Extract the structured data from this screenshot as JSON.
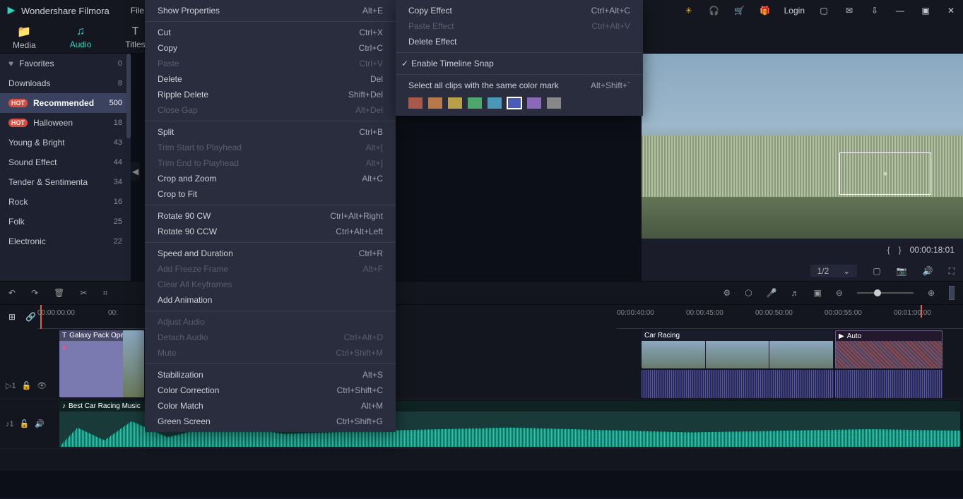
{
  "app_name": "Wondershare Filmora",
  "titlebar_menu": [
    "File"
  ],
  "login_label": "Login",
  "tabs": [
    {
      "label": "Media",
      "active": false
    },
    {
      "label": "Audio",
      "active": true
    },
    {
      "label": "Titles",
      "active": false
    }
  ],
  "sidebar": [
    {
      "label": "Favorites",
      "count": "0",
      "icon": "heart"
    },
    {
      "label": "Downloads",
      "count": "8"
    },
    {
      "label": "Recommended",
      "count": "500",
      "hot": true,
      "active": true
    },
    {
      "label": "Halloween",
      "count": "18",
      "hot": true
    },
    {
      "label": "Young & Bright",
      "count": "43"
    },
    {
      "label": "Sound Effect",
      "count": "44"
    },
    {
      "label": "Tender & Sentimenta",
      "count": "34"
    },
    {
      "label": "Rock",
      "count": "16"
    },
    {
      "label": "Folk",
      "count": "25"
    },
    {
      "label": "Electronic",
      "count": "22"
    }
  ],
  "preview": {
    "time": "00:00:18:01",
    "zoom": "1/2"
  },
  "timeline": {
    "left_start": "00:00:00:00",
    "ticks": [
      "00:00:40:00",
      "00:00:45:00",
      "00:00:50:00",
      "00:00:55:00",
      "00:01:00:00"
    ],
    "clip_title_galaxy": "Galaxy Pack Ope",
    "clip_title_audio": "Best Car Racing Music",
    "clip_title_car": "Car Racing",
    "clip_title_auto": "Auto",
    "track1_label": "1",
    "track2_label": "1"
  },
  "context_menu": {
    "main": [
      {
        "label": "Show Properties",
        "shortcut": "Alt+E"
      },
      {
        "sep": true
      },
      {
        "label": "Cut",
        "shortcut": "Ctrl+X"
      },
      {
        "label": "Copy",
        "shortcut": "Ctrl+C"
      },
      {
        "label": "Paste",
        "shortcut": "Ctrl+V",
        "disabled": true
      },
      {
        "label": "Delete",
        "shortcut": "Del"
      },
      {
        "label": "Ripple Delete",
        "shortcut": "Shift+Del"
      },
      {
        "label": "Close Gap",
        "shortcut": "Alt+Del",
        "disabled": true
      },
      {
        "sep": true
      },
      {
        "label": "Split",
        "shortcut": "Ctrl+B"
      },
      {
        "label": "Trim Start to Playhead",
        "shortcut": "Alt+[",
        "disabled": true
      },
      {
        "label": "Trim End to Playhead",
        "shortcut": "Alt+]",
        "disabled": true
      },
      {
        "label": "Crop and Zoom",
        "shortcut": "Alt+C"
      },
      {
        "label": "Crop to Fit",
        "shortcut": ""
      },
      {
        "sep": true
      },
      {
        "label": "Rotate 90 CW",
        "shortcut": "Ctrl+Alt+Right"
      },
      {
        "label": "Rotate 90 CCW",
        "shortcut": "Ctrl+Alt+Left"
      },
      {
        "sep": true
      },
      {
        "label": "Speed and Duration",
        "shortcut": "Ctrl+R"
      },
      {
        "label": "Add Freeze Frame",
        "shortcut": "Alt+F",
        "disabled": true
      },
      {
        "label": "Clear All Keyframes",
        "shortcut": "",
        "disabled": true
      },
      {
        "label": "Add Animation",
        "shortcut": ""
      },
      {
        "sep": true
      },
      {
        "label": "Adjust Audio",
        "shortcut": "",
        "disabled": true
      },
      {
        "label": "Detach Audio",
        "shortcut": "Ctrl+Alt+D",
        "disabled": true
      },
      {
        "label": "Mute",
        "shortcut": "Ctrl+Shift+M",
        "disabled": true
      },
      {
        "sep": true
      },
      {
        "label": "Stabilization",
        "shortcut": "Alt+S"
      },
      {
        "label": "Color Correction",
        "shortcut": "Ctrl+Shift+C"
      },
      {
        "label": "Color Match",
        "shortcut": "Alt+M"
      },
      {
        "label": "Green Screen",
        "shortcut": "Ctrl+Shift+G"
      }
    ],
    "sub": [
      {
        "label": "Copy Effect",
        "shortcut": "Ctrl+Alt+C"
      },
      {
        "label": "Paste Effect",
        "shortcut": "Ctrl+Alt+V",
        "disabled": true
      },
      {
        "label": "Delete Effect",
        "shortcut": ""
      },
      {
        "sep": true
      },
      {
        "label": "Enable Timeline Snap",
        "shortcut": "",
        "checked": true
      },
      {
        "sep": true
      },
      {
        "label": "Select all clips with the same color mark",
        "shortcut": "Alt+Shift+`"
      }
    ],
    "swatches": [
      "#a85a4a",
      "#b8784a",
      "#b8a04a",
      "#4aa86a",
      "#4a98b8",
      "#4a5ab8",
      "#8a6ab8",
      "#888888"
    ],
    "swatch_selected_index": 5
  }
}
